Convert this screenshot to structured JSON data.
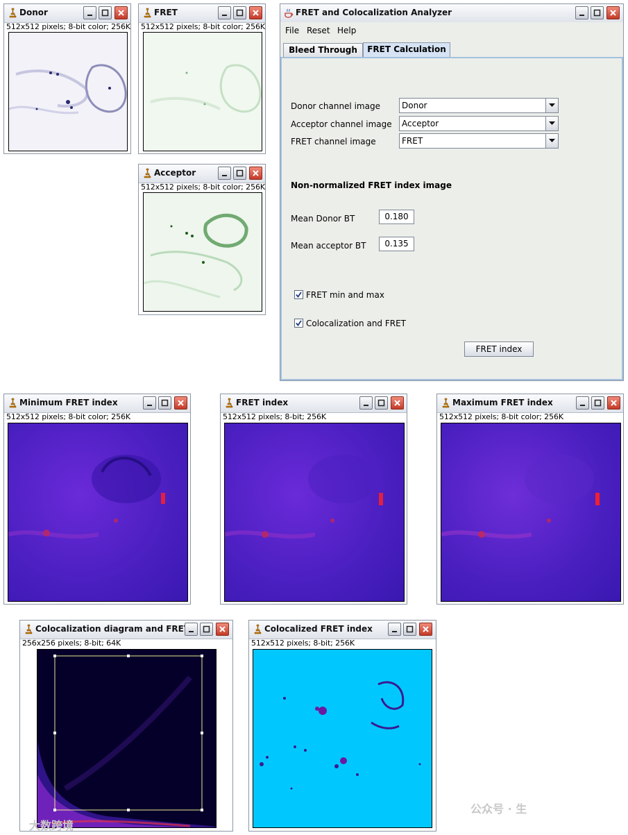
{
  "windows": {
    "donor": {
      "title": "Donor",
      "info": "512x512 pixels; 8-bit color; 256K"
    },
    "fret": {
      "title": "FRET",
      "info": "512x512 pixels; 8-bit color; 256K"
    },
    "acceptor": {
      "title": "Acceptor",
      "info": "512x512 pixels; 8-bit color; 256K"
    },
    "min_fret": {
      "title": "Minimum FRET index",
      "info": "512x512 pixels; 8-bit color; 256K"
    },
    "fret_index": {
      "title": "FRET index",
      "info": "512x512 pixels; 8-bit; 256K"
    },
    "max_fret": {
      "title": "Maximum FRET index",
      "info": "512x512 pixels; 8-bit color; 256K"
    },
    "coloc_diagram": {
      "title": "Colocalization diagram and FRET",
      "info": "256x256 pixels; 8-bit; 64K"
    },
    "coloc_fret": {
      "title": "Colocalized FRET index",
      "info": "512x512 pixels; 8-bit; 256K"
    }
  },
  "analyzer": {
    "title": "FRET and Colocalization Analyzer",
    "menu": [
      "File",
      "Reset",
      "Help"
    ],
    "tabs": [
      {
        "label": "Bleed Through",
        "active": false
      },
      {
        "label": "FRET Calculation",
        "active": true
      }
    ],
    "donor_label": "Donor channel image",
    "donor_value": "Donor",
    "acceptor_label": "Acceptor channel image",
    "acceptor_value": "Acceptor",
    "fret_label": "FRET channel image",
    "fret_value": "FRET",
    "section_title": "Non-normalized FRET index image",
    "mean_donor_label": "Mean Donor BT",
    "mean_donor_value": "0.180",
    "mean_acceptor_label": "Mean acceptor BT",
    "mean_acceptor_value": "0.135",
    "chk_minmax_label": "FRET min and max",
    "chk_minmax_checked": true,
    "chk_coloc_label": "Colocalization and FRET",
    "chk_coloc_checked": true,
    "fret_index_button": "FRET index"
  },
  "colors": {
    "fret_purple": "#5a1fd0",
    "coloc_cyan": "#00c8ff",
    "diagram_bg": "#05002a",
    "selection": "#f0e890"
  },
  "watermark": {
    "left": "大数跨境",
    "right": "公众号 · 生"
  }
}
